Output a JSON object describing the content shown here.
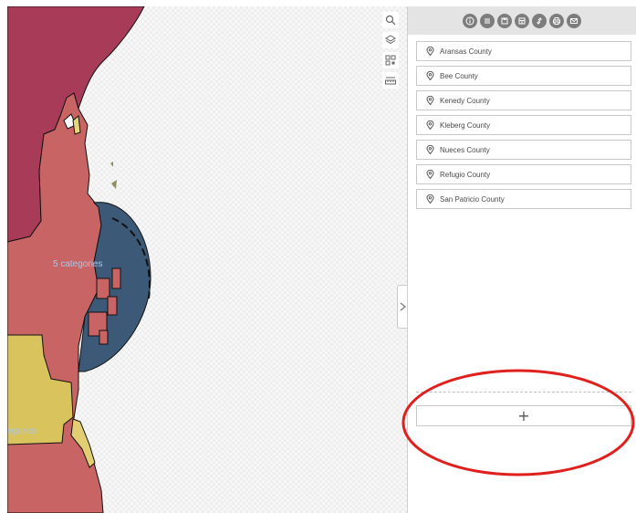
{
  "map": {
    "cluster_labels": [
      "5 categories",
      "egories"
    ],
    "tools": [
      {
        "icon": "search-icon"
      },
      {
        "icon": "layers-icon"
      },
      {
        "icon": "qr-code-icon"
      },
      {
        "icon": "measure-icon"
      }
    ]
  },
  "panel": {
    "toolbar": [
      {
        "icon": "info-icon"
      },
      {
        "icon": "list-icon"
      },
      {
        "icon": "save-icon"
      },
      {
        "icon": "table-icon"
      },
      {
        "icon": "link-icon"
      },
      {
        "icon": "print-icon"
      },
      {
        "icon": "email-icon"
      }
    ],
    "counties": [
      "Aransas County",
      "Bee County",
      "Kenedy County",
      "Kleberg County",
      "Nueces County",
      "Refugio County",
      "San Patricio County"
    ],
    "add_label": "+"
  },
  "colors": {
    "maroon": "#a83c58",
    "salmon": "#c96464",
    "yellow": "#d9c35c",
    "navy": "#3c5a78",
    "annotation": "#e0201c"
  }
}
